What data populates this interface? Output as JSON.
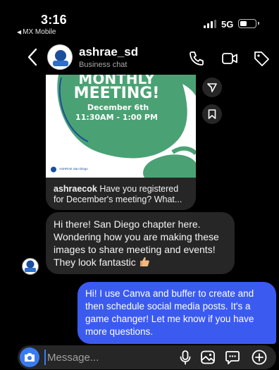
{
  "status_bar": {
    "time": "3:16",
    "carrier": "MX Mobile",
    "network": "5G",
    "battery_level": 0.45
  },
  "header": {
    "username": "ashrae_sd",
    "subtitle": "Business chat",
    "icons": [
      "back-chevron-icon",
      "phone-icon",
      "video-icon",
      "tag-icon"
    ]
  },
  "shared_post": {
    "image_title_line1": "MONTHLY",
    "image_title_line2": "MEETING!",
    "image_date": "December 6th",
    "image_time": "11:30AM - 1:00 PM",
    "image_footer": "ASHRAE San Diego",
    "caption_user": "ashraecok",
    "caption_text": " Have you registered for December's meeting? What...",
    "side_icons": [
      "send-icon",
      "bookmark-icon"
    ]
  },
  "messages": {
    "incoming_text": "Hi there! San Diego chapter here. Wondering how you are making these images to share meeting and events! They look fantastic",
    "incoming_emoji": "thumbs-up-icon",
    "outgoing_text": "Hi! I use Canva and buffer to create and then schedule social media posts. It's a game changer! Let me know if you have more questions."
  },
  "composer": {
    "placeholder": "Message...",
    "icons": [
      "camera-icon",
      "microphone-icon",
      "gallery-icon",
      "sticker-icon",
      "plus-icon"
    ]
  },
  "colors": {
    "background": "#000000",
    "bubble_incoming": "#262626",
    "bubble_outgoing": "#3b5bf0",
    "camera_button": "#3a7bf0",
    "post_green": "#4aa274",
    "avatar_blue": "#1b4f9c"
  }
}
